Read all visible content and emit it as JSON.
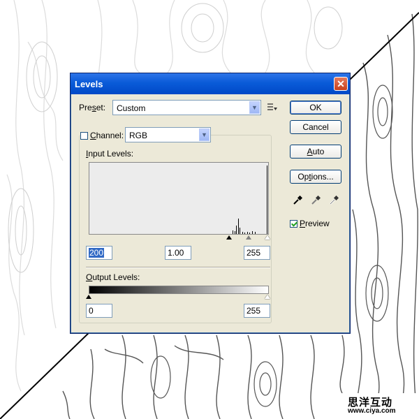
{
  "dialog": {
    "title": "Levels",
    "close_symbol": "✕",
    "preset_label_pre": "Pre",
    "preset_label_u": "s",
    "preset_label_post": "et:",
    "preset_value": "Custom",
    "preset_menu_icon": "preset-options-icon",
    "channel_label_u": "C",
    "channel_label_post": "hannel:",
    "channel_value": "RGB",
    "input_levels_label_u": "I",
    "input_levels_label_post": "nput Levels:",
    "input_black": "200",
    "input_gamma": "1.00",
    "input_white": "255",
    "output_levels_label_u": "O",
    "output_levels_label_post": "utput Levels:",
    "output_black": "0",
    "output_white": "255",
    "buttons": {
      "ok": "OK",
      "cancel": "Cancel",
      "auto_u": "A",
      "auto_post": "uto",
      "options_pre": "Op",
      "options_u": "t",
      "options_post": "ions..."
    },
    "preview_u": "P",
    "preview_post": "review",
    "preview_checked": true,
    "histogram": {
      "description_values": [
        0.05,
        0.04,
        0.12,
        0.22,
        0.09,
        0.03,
        0.02,
        0.03,
        0.02,
        0.04,
        0.03,
        0.98
      ]
    }
  },
  "watermark": {
    "chinese": "思洋互动",
    "url": "www.ciya.com"
  },
  "colors": {
    "titlebar": "#0a5bd8",
    "dialog_bg": "#ece9d8",
    "selection": "#316ac5"
  }
}
